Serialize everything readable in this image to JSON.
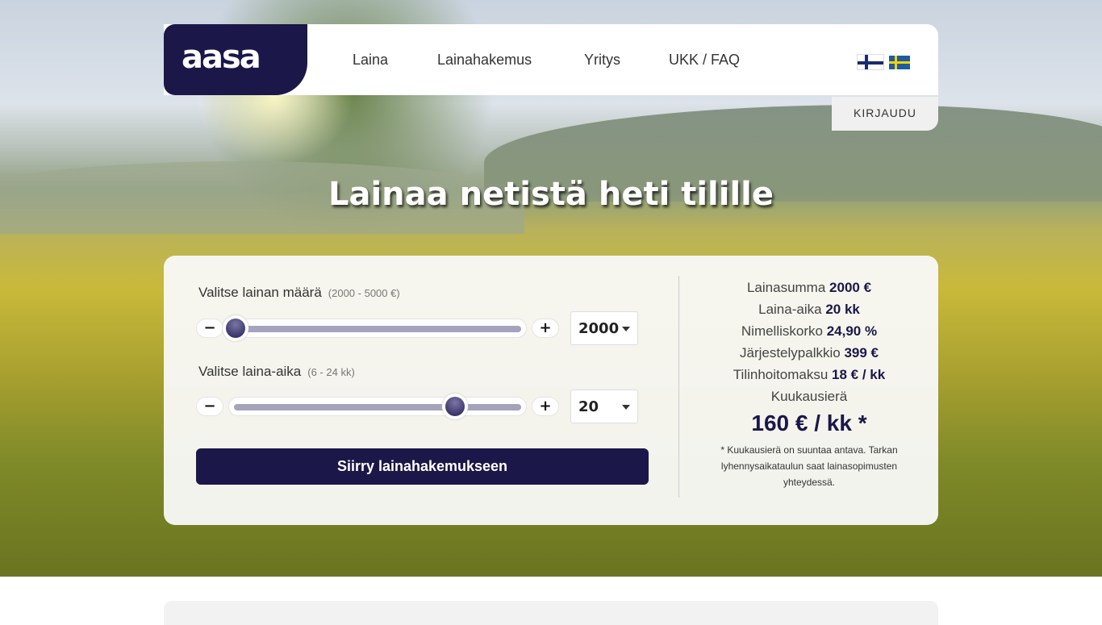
{
  "brand": {
    "logo_text": "aasa",
    "color": "#1b1749"
  },
  "nav": {
    "items": [
      "Laina",
      "Lainahakemus",
      "Yritys",
      "UKK / FAQ"
    ],
    "login": "KIRJAUDU",
    "languages": [
      "fi",
      "sv"
    ]
  },
  "hero": {
    "title": "Lainaa netistä heti tilille"
  },
  "calculator": {
    "amount": {
      "label": "Valitse lainan määrä",
      "range": "(2000 - 5000 €)",
      "value": "2000",
      "min": 2000,
      "max": 5000,
      "current": 2000
    },
    "term": {
      "label": "Valitse laina-aika",
      "range": "(6 - 24 kk)",
      "value": "20",
      "min": 6,
      "max": 24,
      "current": 20
    },
    "minus": "−",
    "plus": "+",
    "cta": "Siirry lainahakemukseen"
  },
  "summary": {
    "rows": [
      {
        "label": "Lainasumma",
        "value": "2000 €"
      },
      {
        "label": "Laina-aika",
        "value": "20 kk"
      },
      {
        "label": "Nimelliskorko",
        "value": "24,90 %"
      },
      {
        "label": "Järjestelypalkkio",
        "value": "399 €"
      },
      {
        "label": "Tilinhoitomaksu",
        "value": "18 € / kk"
      }
    ],
    "monthly_label": "Kuukausierä",
    "monthly_value": "160 € / kk *",
    "note": "* Kuukausierä on suuntaa antava. Tarkan lyhennysaikataulun saat lainasopimusten yhteydessä."
  }
}
